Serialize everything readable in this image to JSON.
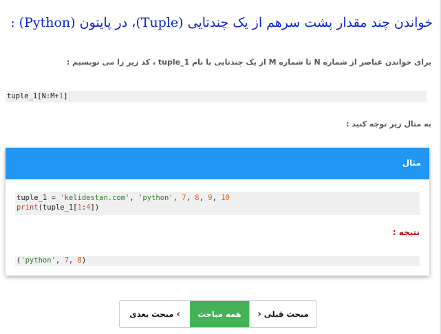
{
  "article": {
    "title": "خواندن چند مقدار پشت سرهم از یک چندتایی (Tuple)، در پایتون (Python) :",
    "intro": "برای خواندن عناصر از شماره N تا شماره M از یک چندتایی با نام tuple_1 ، کد زیر را می نویسیم :",
    "syntax": {
      "name": "tuple_1",
      "open": "[N:M+",
      "one": "1",
      "close": "]"
    },
    "example_note": "به مثال زیر توجه کنید :"
  },
  "example": {
    "header": "مثال",
    "code": {
      "line1": {
        "var": "tuple_1",
        "eq": " = ",
        "s1": "'kelidestan.com'",
        "c1": ", ",
        "s2": "'python'",
        "c2": ", ",
        "n1": "7",
        "c3": ", ",
        "n2": "8",
        "c4": ", ",
        "n3": "9",
        "c5": ", ",
        "n4": "10"
      },
      "line2": {
        "kw": "print",
        "p1": "(tuple_1[",
        "n1": "1",
        "colon": ":",
        "n2": "4",
        "p2": "])"
      }
    },
    "result_label": "نتیجه :",
    "output": {
      "open": "(",
      "str": "'python'",
      "c1": ", ",
      "n1": "7",
      "c2": ", ",
      "n2": "8",
      "close": ")"
    }
  },
  "pager": {
    "next": {
      "label": "مبحث بعدی",
      "icon": "›"
    },
    "all": {
      "label": "همه مباحث"
    },
    "prev": {
      "label": "مبحث قبلی",
      "icon": "‹"
    }
  },
  "colors": {
    "title": "#0b24cc",
    "header_bg": "#2196f3",
    "result_label": "#cc0000",
    "all_button_bg": "#44b358",
    "number": "#e8590c",
    "string": "#2b7f2b"
  }
}
